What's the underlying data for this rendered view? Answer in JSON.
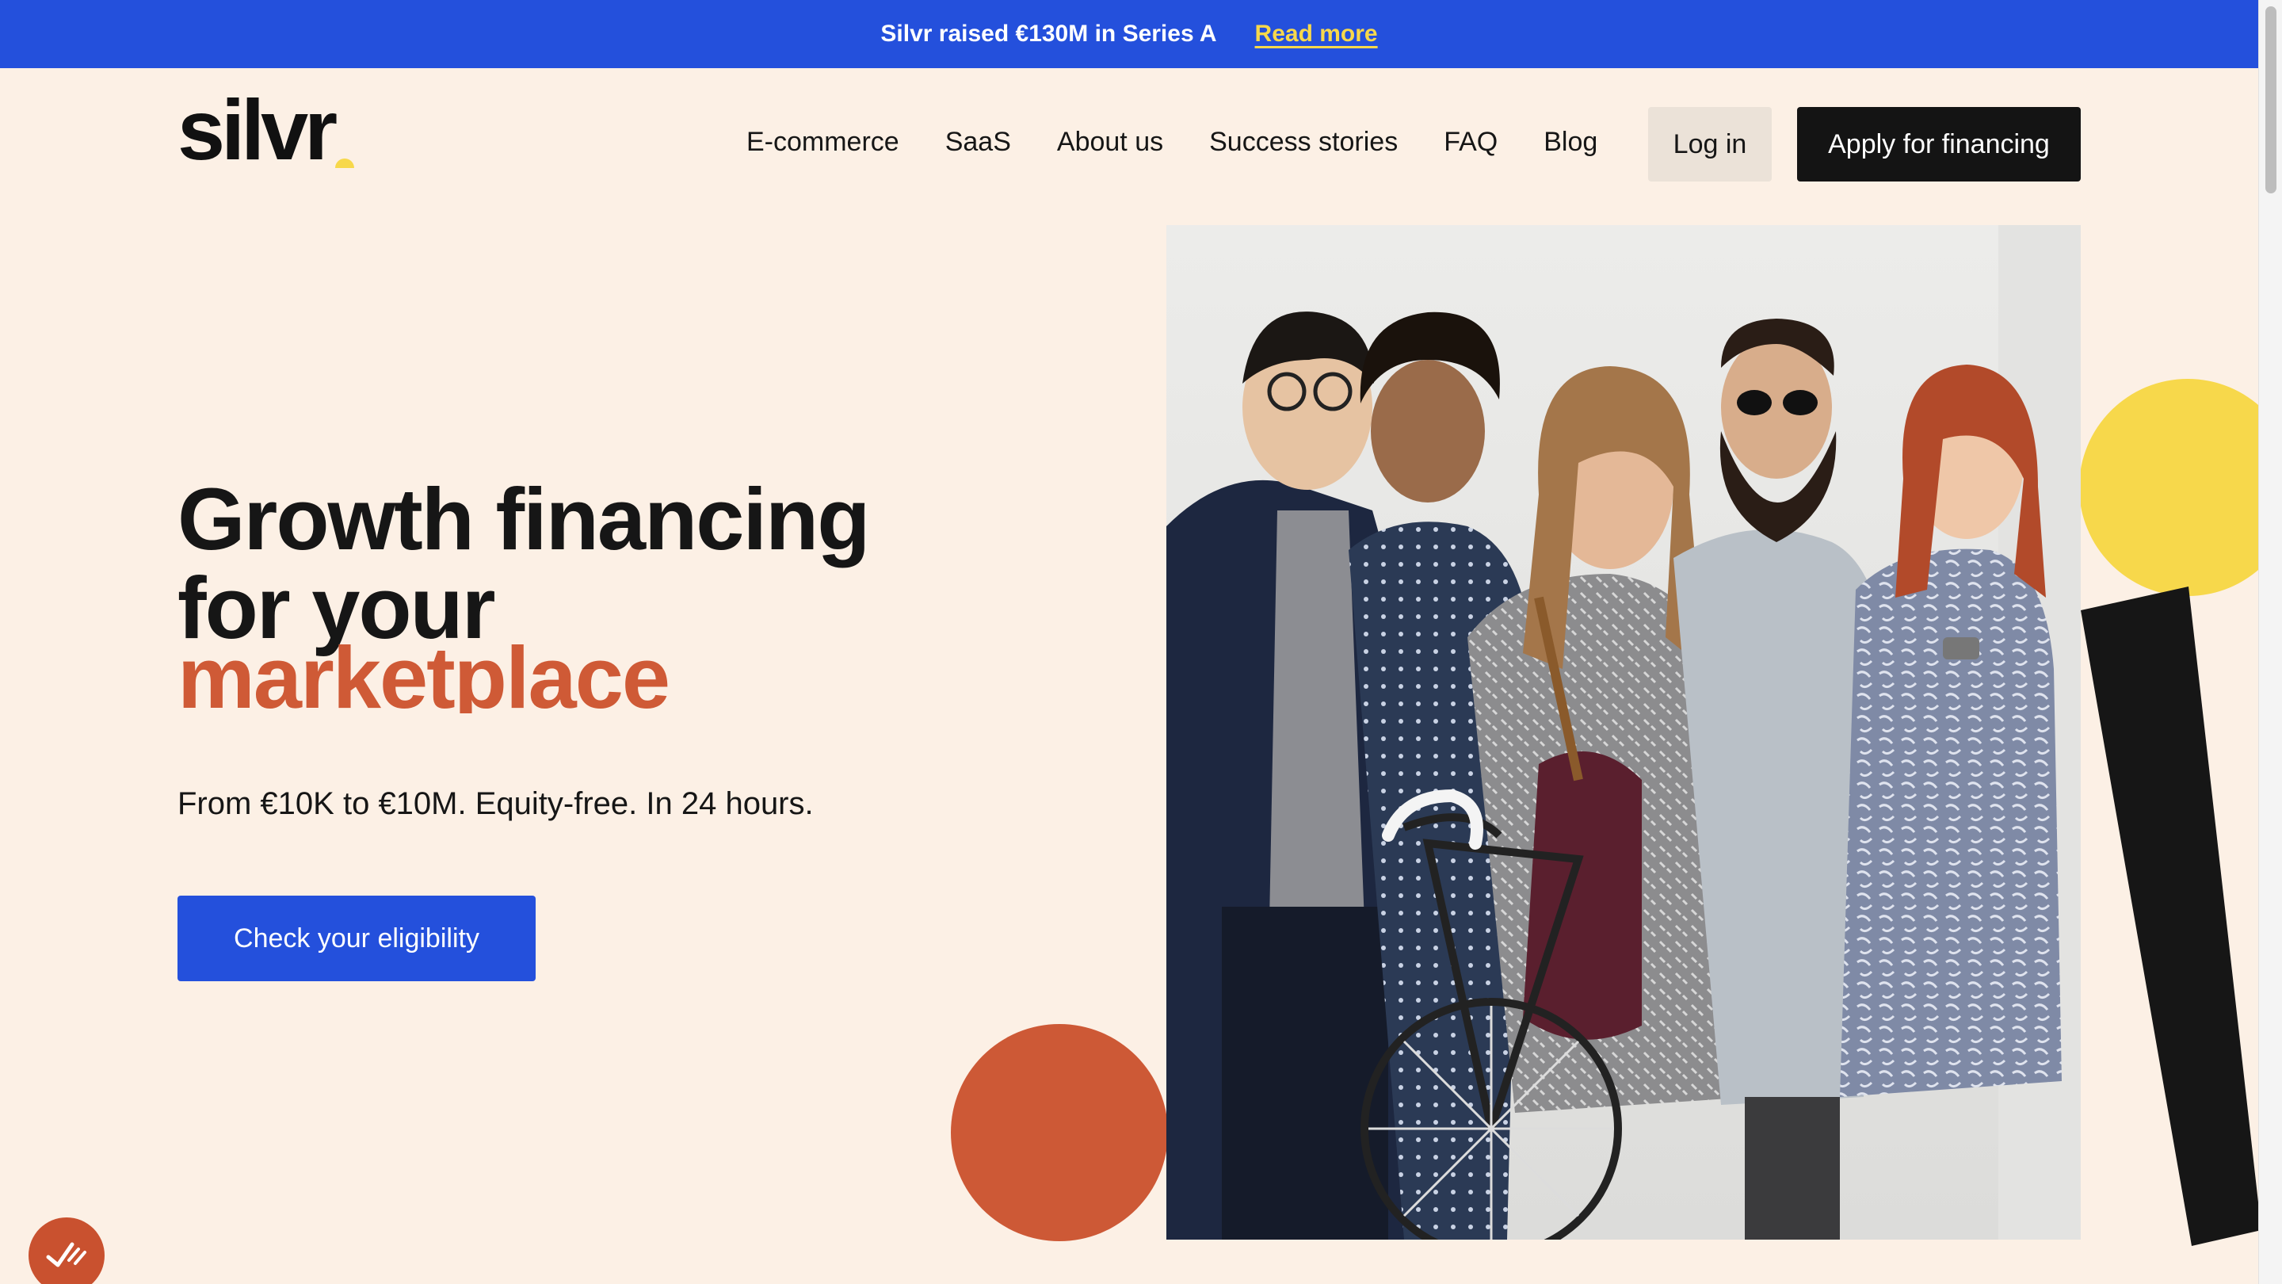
{
  "announcement": {
    "message": "Silvr raised €130M in Series A",
    "link_label": "Read more"
  },
  "brand": {
    "logo_text": "silvr",
    "colors": {
      "cream": "#fcf0e5",
      "blue": "#2450dc",
      "orange": "#cf5a36",
      "yellow": "#f7d84b",
      "black": "#141414"
    }
  },
  "nav": {
    "items": [
      "E-commerce",
      "SaaS",
      "About us",
      "Success stories",
      "FAQ",
      "Blog"
    ],
    "login_label": "Log in",
    "apply_label": "Apply for financing"
  },
  "hero": {
    "title": "Growth financing for your",
    "accent_word": "marketplace",
    "subtitle": "From €10K to €10M. Equity-free. In 24 hours.",
    "cta_label": "Check your eligibility"
  },
  "icons": {
    "badge": "checkmark-signature-icon"
  }
}
